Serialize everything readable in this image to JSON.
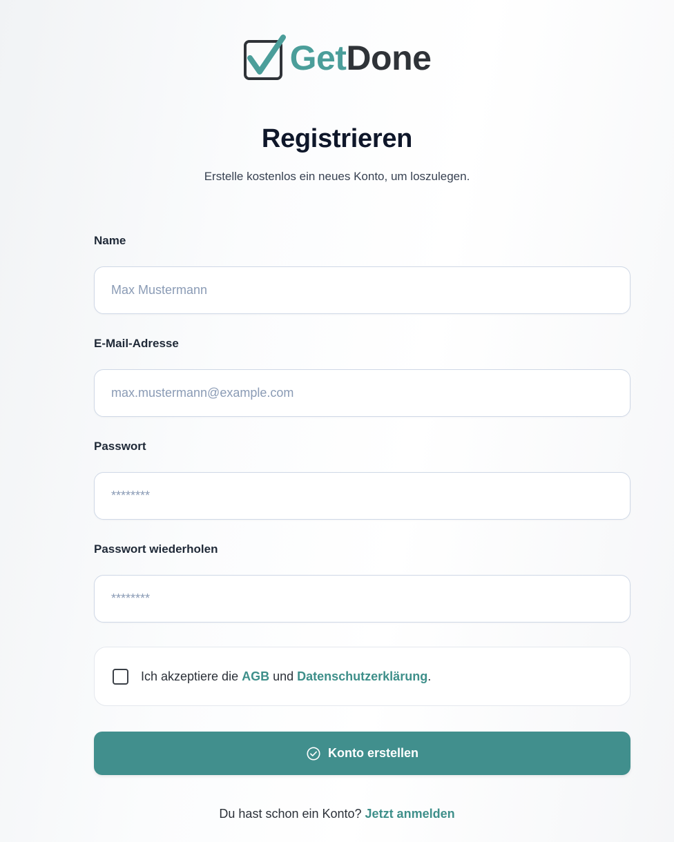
{
  "brand": {
    "part1": "Get",
    "part2": "Done",
    "accent_color": "#4b9e9a",
    "dark_color": "#2f3338",
    "icon": "checkbox-check-icon"
  },
  "heading": {
    "title": "Registrieren",
    "subtitle": "Erstelle kostenlos ein neues Konto, um loszulegen."
  },
  "form": {
    "name": {
      "label": "Name",
      "placeholder": "Max Mustermann"
    },
    "email": {
      "label": "E-Mail-Adresse",
      "placeholder": "max.mustermann@example.com"
    },
    "password": {
      "label": "Passwort",
      "placeholder": "********"
    },
    "password_repeat": {
      "label": "Passwort wiederholen",
      "placeholder": "********"
    },
    "terms": {
      "text_before": "Ich akzeptiere die ",
      "agb_link": "AGB",
      "text_middle": " und ",
      "privacy_link": "Datenschutzerklärung",
      "text_after": ".",
      "checked": false
    },
    "submit": {
      "label": "Konto erstellen",
      "icon": "check-circle-icon",
      "color": "#418f8d"
    }
  },
  "footer": {
    "prompt": "Du hast schon ein Konto? ",
    "login_link": "Jetzt anmelden"
  }
}
